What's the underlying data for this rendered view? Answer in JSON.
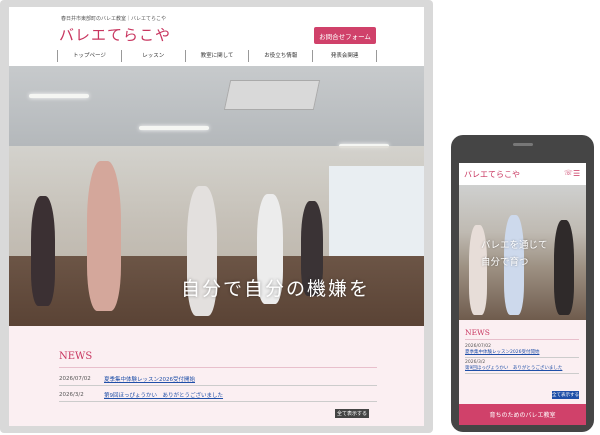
{
  "desktop": {
    "tagline": "春日井市東部町のバレエ教室｜バレエてらこや",
    "logo": "バレエてらこや",
    "contact_button": "お問合せフォーム",
    "nav": [
      "トップページ",
      "レッスン",
      "教室に関して",
      "お役立ち情報",
      "発表会関連"
    ],
    "hero_text": "自分で自分の機嫌を",
    "news": {
      "title": "NEWS",
      "items": [
        {
          "date": "2026/07/02",
          "title": "夏季集中体験レッスン2026受付開始"
        },
        {
          "date": "2026/3/2",
          "title": "第9回ほっぴょうかい　ありがとうございました"
        }
      ],
      "more_label": "全て表示する"
    }
  },
  "mobile": {
    "logo": "バレエてらこや",
    "tel_icon": "phone-icon",
    "menu_icon": "hamburger-menu-icon",
    "hero_line1": "バレエを通じて",
    "hero_line2": "自分で育つ",
    "news": {
      "title": "NEWS",
      "items": [
        {
          "date": "2026/07/02",
          "title": "夏季集中体験レッスン2026受付開始"
        },
        {
          "date": "2026/3/2",
          "title": "第9回ほっぴょうかい　ありがとうございました"
        }
      ],
      "more_label": "全て表示する"
    },
    "footer_label": "育ちのためのバレエ教室"
  },
  "colors": {
    "brand": "#c8355f",
    "button": "#d0416a",
    "news_bg": "#fbeff2",
    "link": "#1f4fa8"
  }
}
